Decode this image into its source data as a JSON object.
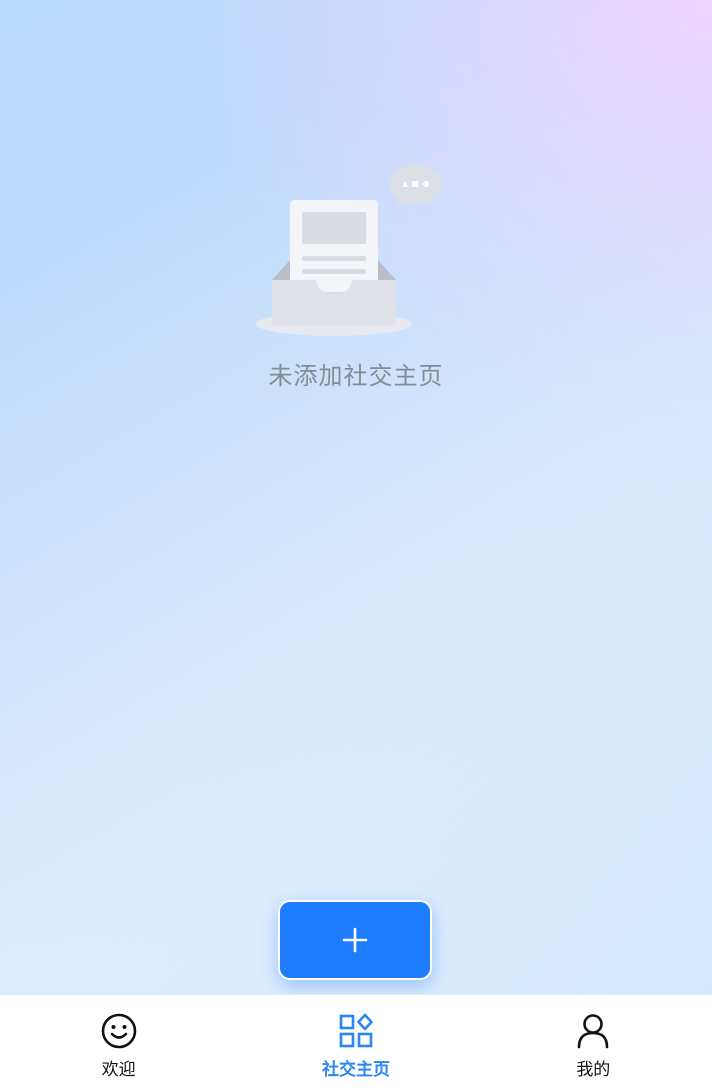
{
  "empty_state": {
    "message": "未添加社交主页",
    "illustration_icon": "empty-inbox-icon"
  },
  "fab": {
    "icon": "plus-icon",
    "color": "#1e7cff"
  },
  "tab_bar": {
    "active_color": "#2a86f0",
    "items": [
      {
        "label": "欢迎",
        "icon": "smile-icon",
        "active": false
      },
      {
        "label": "社交主页",
        "icon": "grid-apps-icon",
        "active": true
      },
      {
        "label": "我的",
        "icon": "user-icon",
        "active": false
      }
    ]
  }
}
